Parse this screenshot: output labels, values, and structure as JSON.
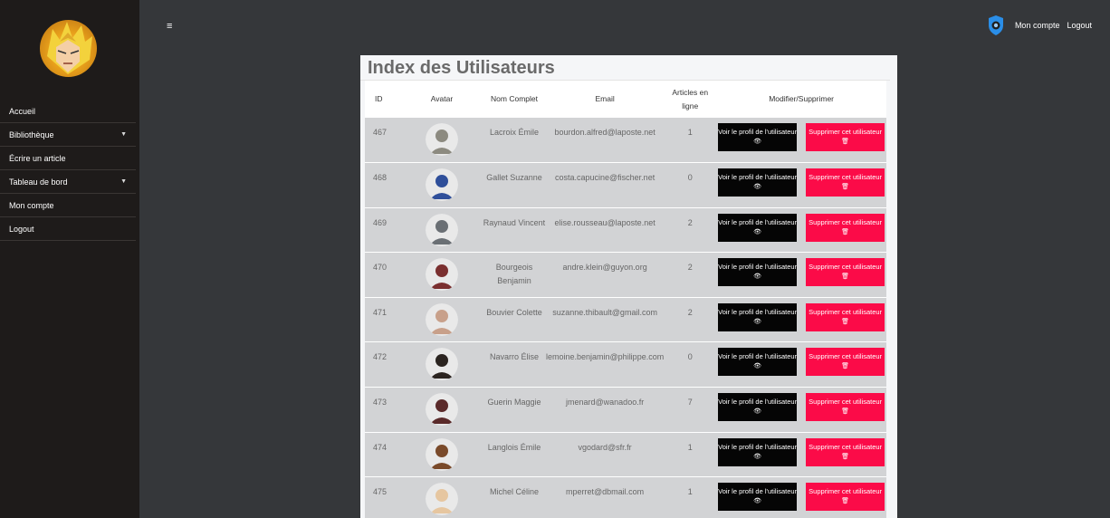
{
  "sidebar": {
    "items": [
      {
        "label": "Accueil",
        "dropdown": false
      },
      {
        "label": "Bibliothèque",
        "dropdown": true
      },
      {
        "label": "Écrire un article",
        "dropdown": false
      },
      {
        "label": "Tableau de bord",
        "dropdown": true
      },
      {
        "label": "Mon compte",
        "dropdown": false
      },
      {
        "label": "Logout",
        "dropdown": false
      }
    ]
  },
  "topbar": {
    "menu_icon": "≡",
    "account_label": "Mon compte",
    "logout_label": "Logout"
  },
  "main": {
    "title": "Index des Utilisateurs",
    "columns": [
      "ID",
      "Avatar",
      "Nom Complet",
      "Email",
      "Articles en ligne",
      "Modifier/Supprimer"
    ],
    "view_label": "Voir le profil de l'utilisateur",
    "delete_label": "Supprimer cet utilisateur",
    "rows": [
      {
        "id": "467",
        "name": "Lacroix Émile",
        "email": "bourdon.alfred@laposte.net",
        "articles": "1",
        "avatar_color": "#8c8a80"
      },
      {
        "id": "468",
        "name": "Gallet Suzanne",
        "email": "costa.capucine@fischer.net",
        "articles": "0",
        "avatar_color": "#2f4f9a"
      },
      {
        "id": "469",
        "name": "Raynaud Vincent",
        "email": "elise.rousseau@laposte.net",
        "articles": "2",
        "avatar_color": "#6a6f74"
      },
      {
        "id": "470",
        "name": "Bourgeois Benjamin",
        "email": "andre.klein@guyon.org",
        "articles": "2",
        "avatar_color": "#7a2f2f"
      },
      {
        "id": "471",
        "name": "Bouvier Colette",
        "email": "suzanne.thibault@gmail.com",
        "articles": "2",
        "avatar_color": "#c8a08a"
      },
      {
        "id": "472",
        "name": "Navarro Élise",
        "email": "lemoine.benjamin@philippe.com",
        "articles": "0",
        "avatar_color": "#2b2420"
      },
      {
        "id": "473",
        "name": "Guerin Maggie",
        "email": "jmenard@wanadoo.fr",
        "articles": "7",
        "avatar_color": "#5a2a2a"
      },
      {
        "id": "474",
        "name": "Langlois Émile",
        "email": "vgodard@sfr.fr",
        "articles": "1",
        "avatar_color": "#7a4a2a"
      },
      {
        "id": "475",
        "name": "Michel Céline",
        "email": "mperret@dbmail.com",
        "articles": "1",
        "avatar_color": "#e6c6a0"
      }
    ]
  },
  "colors": {
    "sidebar_bg": "#1e1b1a",
    "page_bg": "#35373a",
    "row_bg": "#d2d3d5",
    "view_button": "#050505",
    "delete_button": "#fb0b48",
    "shield_icon": "#2a8ee8"
  },
  "icons": {
    "menu": "hamburger-icon",
    "account": "shield-icon",
    "view": "eye-icon",
    "delete": "trash-icon",
    "dropdown": "caret-down-icon"
  }
}
